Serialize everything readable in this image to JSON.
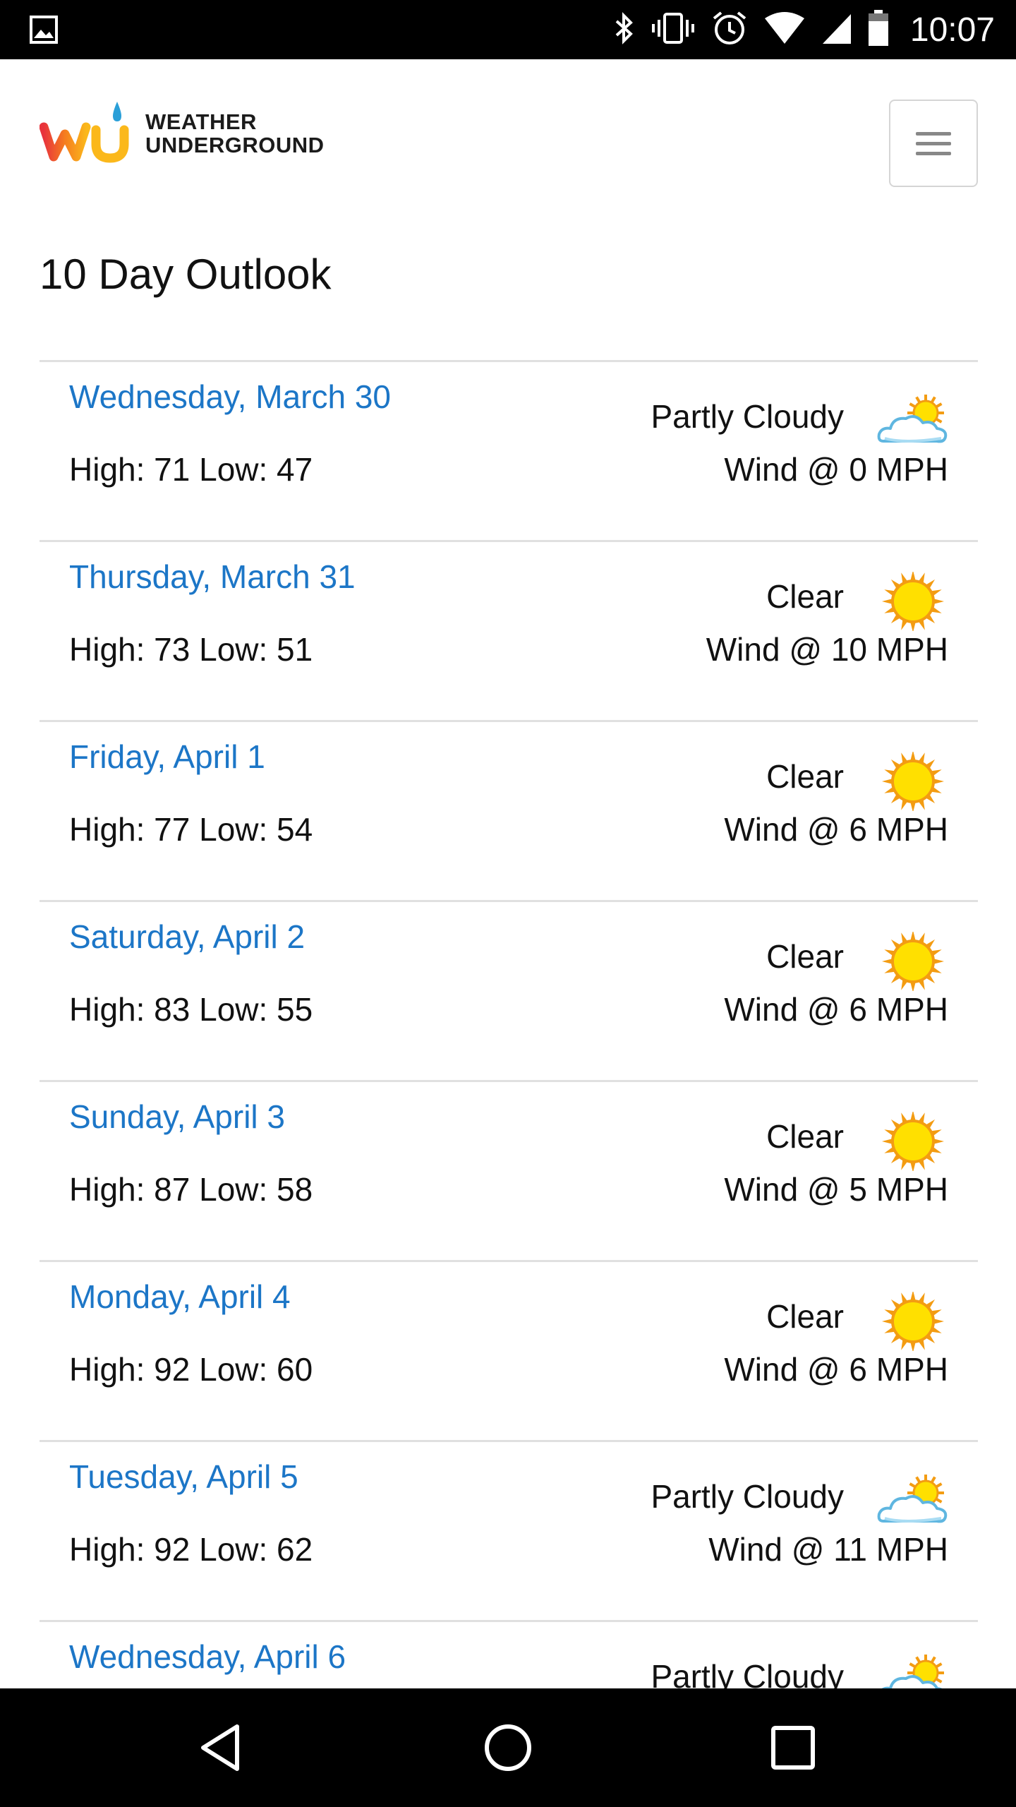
{
  "status_bar": {
    "time": "10:07",
    "icons": [
      "image-icon",
      "bluetooth-icon",
      "vibrate-icon",
      "alarm-icon",
      "wifi-icon",
      "signal-icon",
      "battery-icon"
    ]
  },
  "header": {
    "logo_line1": "WEATHER",
    "logo_line2": "UNDERGROUND",
    "menu_icon": "hamburger-menu-icon"
  },
  "page_title": "10 Day Outlook",
  "forecast": [
    {
      "day": "Wednesday, March 30",
      "temps": "High: 71 Low: 47",
      "condition": "Partly Cloudy",
      "wind": "Wind @ 0 MPH",
      "icon": "partly-cloudy"
    },
    {
      "day": "Thursday, March 31",
      "temps": "High: 73 Low: 51",
      "condition": "Clear",
      "wind": "Wind @ 10 MPH",
      "icon": "clear"
    },
    {
      "day": "Friday, April 1",
      "temps": "High: 77 Low: 54",
      "condition": "Clear",
      "wind": "Wind @ 6 MPH",
      "icon": "clear"
    },
    {
      "day": "Saturday, April 2",
      "temps": "High: 83 Low: 55",
      "condition": "Clear",
      "wind": "Wind @ 6 MPH",
      "icon": "clear"
    },
    {
      "day": "Sunday, April 3",
      "temps": "High: 87 Low: 58",
      "condition": "Clear",
      "wind": "Wind @ 5 MPH",
      "icon": "clear"
    },
    {
      "day": "Monday, April 4",
      "temps": "High: 92 Low: 60",
      "condition": "Clear",
      "wind": "Wind @ 6 MPH",
      "icon": "clear"
    },
    {
      "day": "Tuesday, April 5",
      "temps": "High: 92 Low: 62",
      "condition": "Partly Cloudy",
      "wind": "Wind @ 11 MPH",
      "icon": "partly-cloudy"
    },
    {
      "day": "Wednesday, April 6",
      "temps": "",
      "condition": "Partly Cloudy",
      "wind": "",
      "icon": "partly-cloudy"
    }
  ],
  "colors": {
    "link_blue": "#1c76c7",
    "divider": "#e0e0e0",
    "sun_orange": "#f39c12",
    "sun_yellow": "#ffe000"
  },
  "nav_bar": {
    "icons": [
      "back-icon",
      "home-icon",
      "recents-icon"
    ]
  }
}
